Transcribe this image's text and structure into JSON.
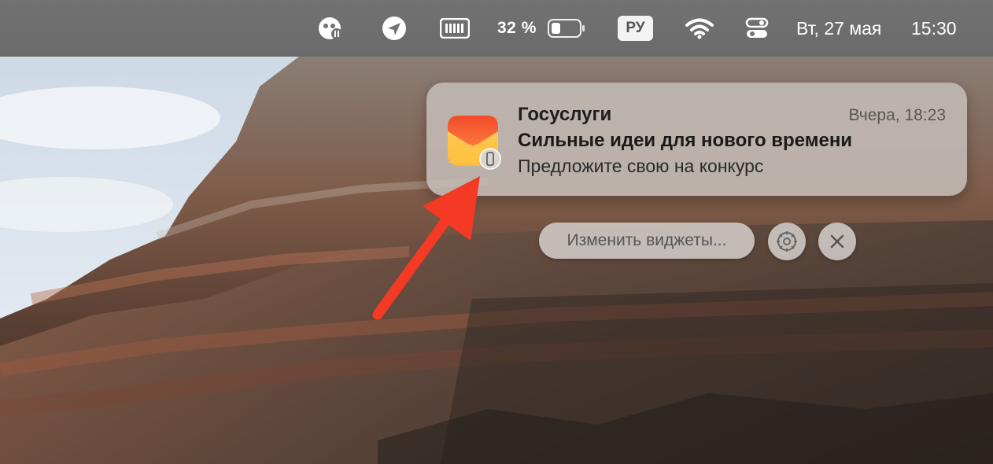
{
  "menubar": {
    "icons": [
      "game-controller-icon",
      "location-arrow-icon",
      "barcode-icon",
      "battery-icon",
      "wifi-icon",
      "control-center-icon"
    ],
    "battery_percent_label": "32 %",
    "battery_level": 0.32,
    "input_language": "РУ",
    "date": "Вт, 27 мая",
    "time": "15:30"
  },
  "notification": {
    "app_icon": "mail-envelope-icon",
    "badge_icon": "phone-icon",
    "app_name": "Госуслуги",
    "time": "Вчера, 18:23",
    "subject": "Сильные идеи для нового времени",
    "body": "Предложите свою на конкурс"
  },
  "widgets": {
    "edit_label": "Изменить виджеты...",
    "settings_icon": "gear-icon",
    "close_icon": "close-icon"
  },
  "colors": {
    "annotation_arrow": "#f43a24",
    "mail_icon_top": "#f65a2e",
    "mail_icon_bottom": "#ffc94a"
  }
}
